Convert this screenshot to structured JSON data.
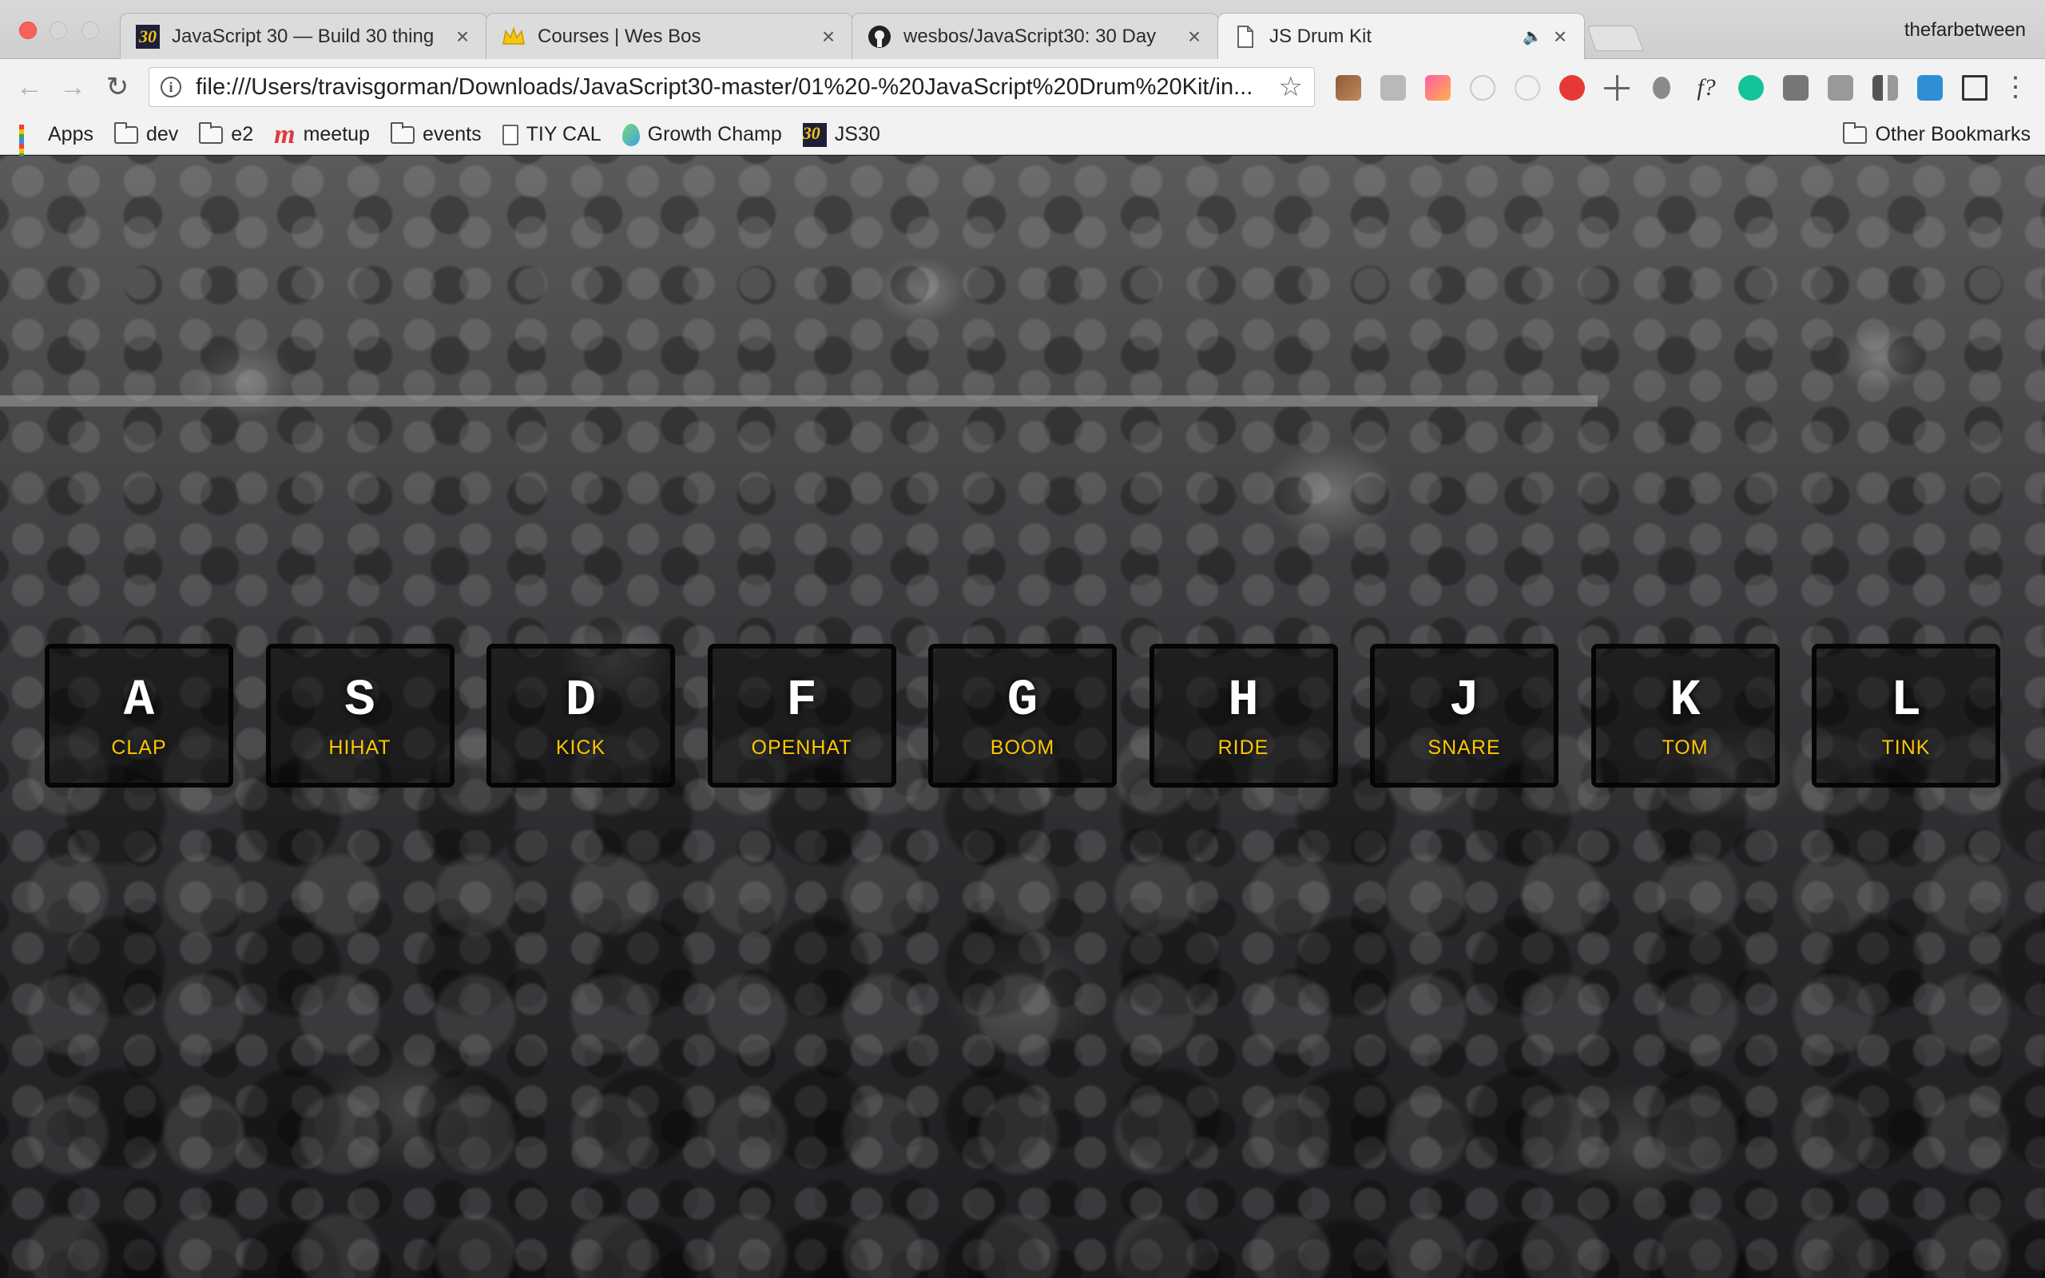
{
  "window": {
    "profile_name": "thefarbetween"
  },
  "tabs": [
    {
      "title": "JavaScript 30 — Build 30 thing",
      "favicon": "js30-icon",
      "active": false
    },
    {
      "title": "Courses | Wes Bos",
      "favicon": "crown-icon",
      "active": false
    },
    {
      "title": "wesbos/JavaScript30: 30 Day",
      "favicon": "github-icon",
      "active": false
    },
    {
      "title": "JS Drum Kit",
      "favicon": "page-icon",
      "active": true
    }
  ],
  "toolbar": {
    "url": "file:///Users/travisgorman/Downloads/JavaScript30-master/01%20-%20JavaScript%20Drum%20Kit/in...",
    "colors": {
      "close": "#fc605c",
      "accent": "#ffc600"
    }
  },
  "bookmarks": {
    "items": [
      {
        "label": "Apps",
        "icon": "apps-grid-icon"
      },
      {
        "label": "dev",
        "icon": "folder-icon"
      },
      {
        "label": "e2",
        "icon": "folder-icon"
      },
      {
        "label": "meetup",
        "icon": "meetup-icon"
      },
      {
        "label": "events",
        "icon": "folder-icon"
      },
      {
        "label": "TIY CAL",
        "icon": "document-icon"
      },
      {
        "label": "Growth Champ",
        "icon": "droplet-icon"
      },
      {
        "label": "JS30",
        "icon": "js30-icon"
      }
    ],
    "other": "Other Bookmarks"
  },
  "drum_kit": {
    "keys": [
      {
        "key": "A",
        "sound": "CLAP"
      },
      {
        "key": "S",
        "sound": "HIHAT"
      },
      {
        "key": "D",
        "sound": "KICK"
      },
      {
        "key": "F",
        "sound": "OPENHAT"
      },
      {
        "key": "G",
        "sound": "BOOM"
      },
      {
        "key": "H",
        "sound": "RIDE"
      },
      {
        "key": "J",
        "sound": "SNARE"
      },
      {
        "key": "K",
        "sound": "TOM"
      },
      {
        "key": "L",
        "sound": "TINK"
      }
    ]
  }
}
